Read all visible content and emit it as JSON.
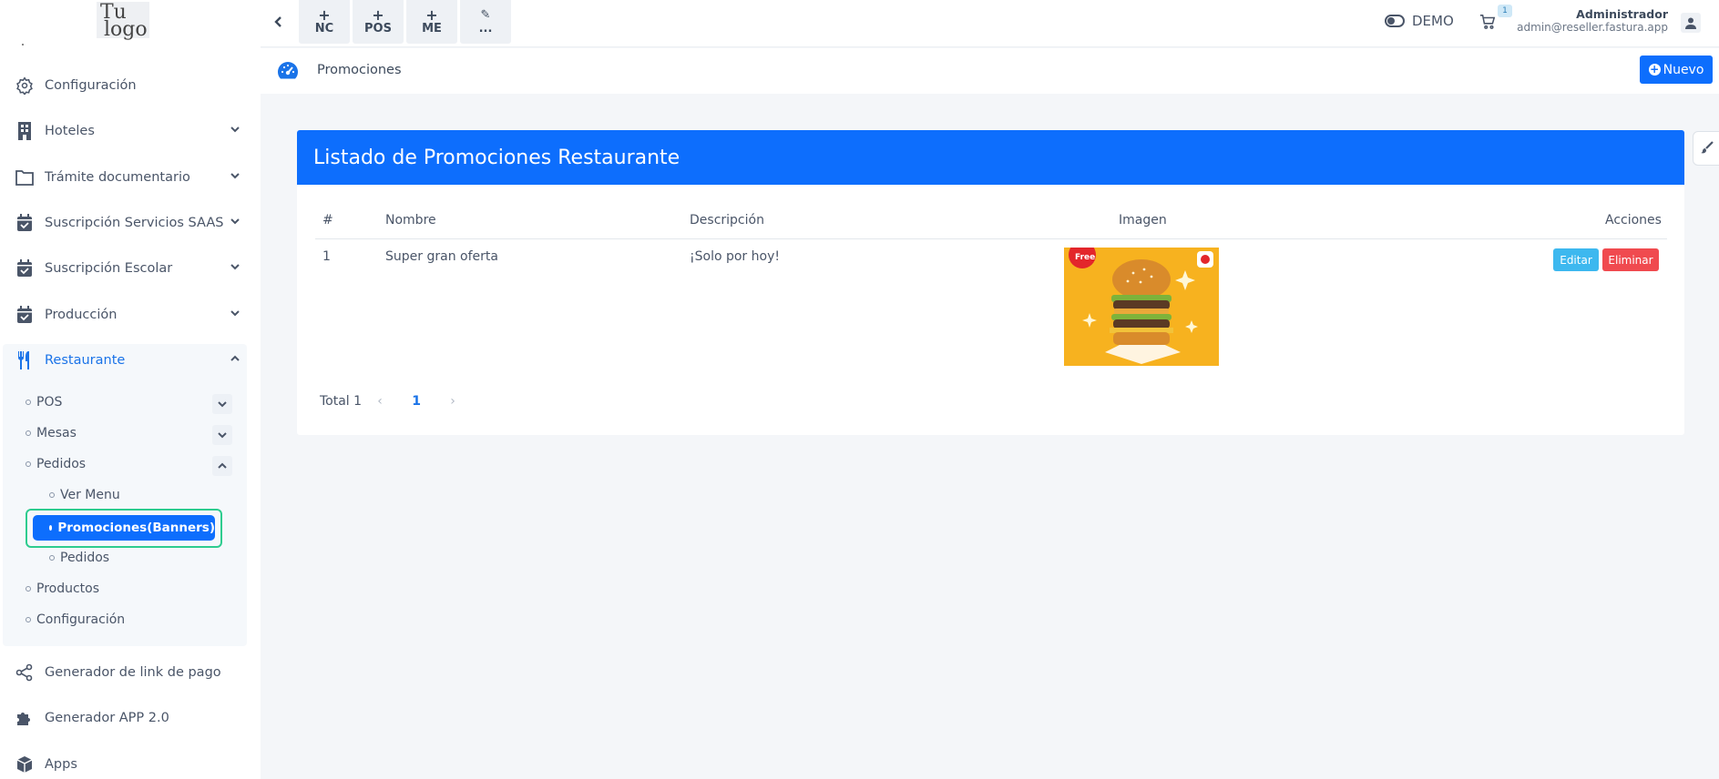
{
  "logo": {
    "line1": "Tu",
    "line2": "logo"
  },
  "sidebar": {
    "items": [
      {
        "label": "Configuración",
        "icon": "gear-icon"
      },
      {
        "label": "Hoteles",
        "icon": "building-icon"
      },
      {
        "label": "Trámite documentario",
        "icon": "folder-icon"
      },
      {
        "label": "Suscripción Servicios SAAS",
        "icon": "calendar-check-icon"
      },
      {
        "label": "Suscripción Escolar",
        "icon": "calendar-check-icon"
      },
      {
        "label": "Producción",
        "icon": "calendar-check-icon"
      },
      {
        "label": "Restaurante",
        "icon": "utensils-icon"
      },
      {
        "label": "Generador de link de pago",
        "icon": "share-icon"
      },
      {
        "label": "Generador APP 2.0",
        "icon": "puzzle-icon"
      },
      {
        "label": "Apps",
        "icon": "cube-icon"
      }
    ],
    "restaurant_sub": {
      "pos": "POS",
      "mesas": "Mesas",
      "pedidos": "Pedidos",
      "ver_menu": "Ver Menu",
      "promociones": "Promociones(Banners)",
      "pedidos_sub": "Pedidos",
      "productos": "Productos",
      "configuracion": "Configuración"
    }
  },
  "topbar": {
    "quick": [
      {
        "plus": "+",
        "label": "NC"
      },
      {
        "plus": "+",
        "label": "POS"
      },
      {
        "plus": "+",
        "label": "ME"
      },
      {
        "plus": "✎",
        "label": "..."
      }
    ],
    "demo_label": "DEMO",
    "cart_count": "1",
    "user_name": "Administrador",
    "user_email": "admin@reseller.fastura.app"
  },
  "breadcrumb": {
    "title": "Promociones",
    "new_button": "Nuevo"
  },
  "card": {
    "title": "Listado de Promociones Restaurante",
    "columns": [
      "#",
      "Nombre",
      "Descripción",
      "Imagen",
      "Acciones"
    ],
    "rows": [
      {
        "num": "1",
        "name": "Super gran oferta",
        "description": "¡Solo por hoy!",
        "image_badge": "Free",
        "edit": "Editar",
        "delete": "Eliminar"
      }
    ],
    "pager": {
      "total": "Total 1",
      "page": "1"
    }
  },
  "colors": {
    "primary": "#0d6efd",
    "edit": "#3db8ef",
    "delete": "#f04a4f",
    "highlight": "#2ecc8f"
  }
}
